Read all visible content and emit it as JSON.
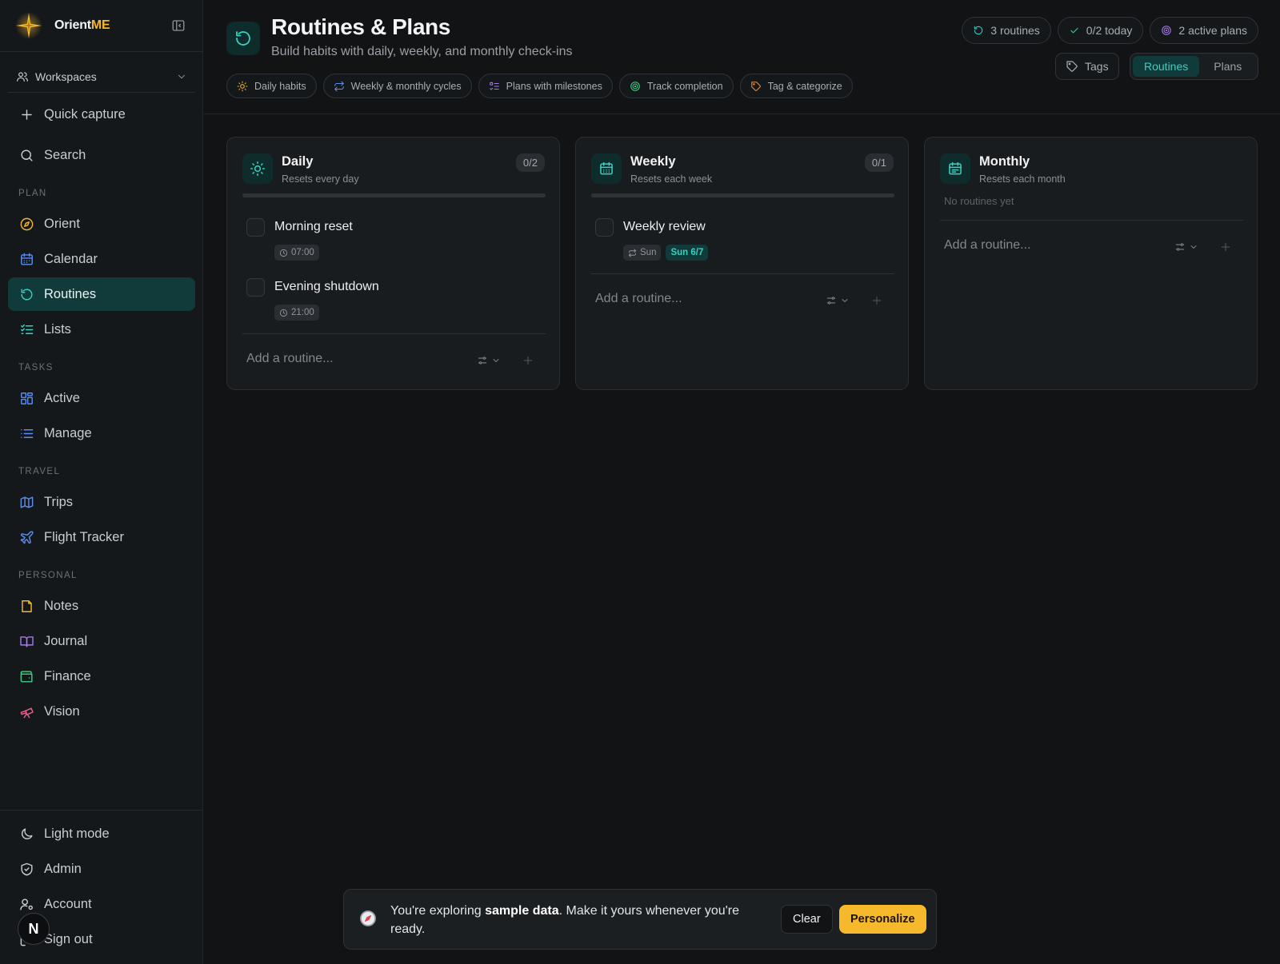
{
  "brand": {
    "name_prefix": "Orient",
    "name_accent": "ME"
  },
  "sidebar": {
    "workspaces_label": "Workspaces",
    "quick_capture": "Quick capture",
    "search": "Search",
    "sections": {
      "plan": "PLAN",
      "tasks": "TASKS",
      "travel": "TRAVEL",
      "personal": "PERSONAL"
    },
    "items": {
      "orient": "Orient",
      "calendar": "Calendar",
      "routines": "Routines",
      "lists": "Lists",
      "active": "Active",
      "manage": "Manage",
      "trips": "Trips",
      "flight_tracker": "Flight Tracker",
      "notes": "Notes",
      "journal": "Journal",
      "finance": "Finance",
      "vision": "Vision"
    },
    "footer": {
      "light_mode": "Light mode",
      "admin": "Admin",
      "account": "Account",
      "sign_out": "Sign out"
    },
    "avatar_letter": "N",
    "active_item": "routines"
  },
  "header": {
    "title": "Routines & Plans",
    "subtitle": "Build habits with daily, weekly, and monthly check-ins",
    "chips": [
      "Daily habits",
      "Weekly & monthly cycles",
      "Plans with milestones",
      "Track completion",
      "Tag & categorize"
    ],
    "stats": [
      "3 routines",
      "0/2 today",
      "2 active plans"
    ],
    "tags_label": "Tags",
    "view_toggle": {
      "routines": "Routines",
      "plans": "Plans",
      "selected": "Routines"
    }
  },
  "cards": {
    "daily": {
      "title": "Daily",
      "subtitle": "Resets every day",
      "count": "0/2",
      "progress": 0,
      "items": [
        {
          "title": "Morning reset",
          "time": "07:00"
        },
        {
          "title": "Evening shutdown",
          "time": "21:00"
        }
      ],
      "add_placeholder": "Add a routine..."
    },
    "weekly": {
      "title": "Weekly",
      "subtitle": "Resets each week",
      "count": "0/1",
      "progress": 0,
      "items": [
        {
          "title": "Weekly review",
          "repeat": "Sun",
          "due": "Sun 6/7"
        }
      ],
      "add_placeholder": "Add a routine..."
    },
    "monthly": {
      "title": "Monthly",
      "subtitle": "Resets each month",
      "empty": "No routines yet",
      "add_placeholder": "Add a routine..."
    }
  },
  "toast": {
    "text_before": "You're exploring ",
    "text_strong": "sample data",
    "text_after": ". Make it yours whenever you're ready.",
    "clear_label": "Clear",
    "personalize_label": "Personalize"
  },
  "colors": {
    "accent_teal": "#3ad1c1",
    "accent_yellow": "#f6b92b",
    "background": "#111315",
    "sidebar": "#15181b",
    "active_nav": "#113a3a"
  }
}
